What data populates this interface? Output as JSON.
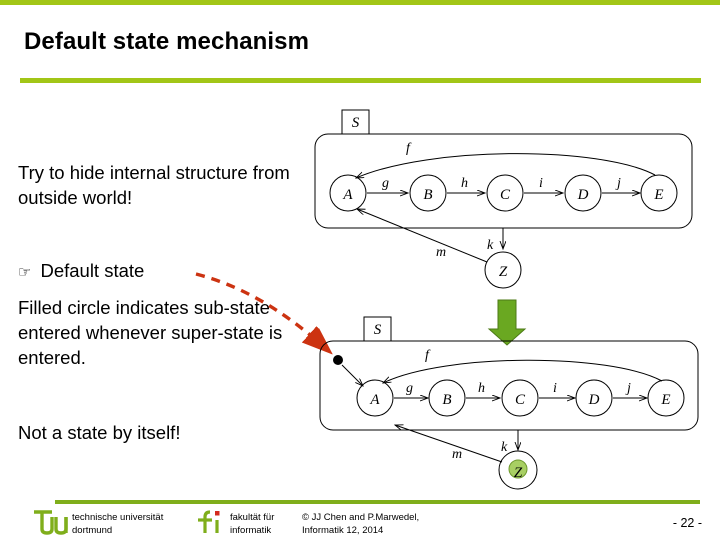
{
  "slide": {
    "title": "Default state mechanism",
    "page_number": "- 22 -",
    "accent_color": "#a2c617",
    "rule_color": "#7fae1b",
    "highlight_color": "#6aa821",
    "annotation_color": "#cc3311"
  },
  "body": {
    "paragraph_1": "Try to hide internal structure from outside world!",
    "bullet_glyph": "☞",
    "bullet_1": "Default state",
    "paragraph_2": "Filled circle indicates sub-state entered whenever super-state is entered.",
    "paragraph_3": "Not a state by itself!"
  },
  "diagram_top": {
    "super_state_label": "S",
    "states": [
      "A",
      "B",
      "C",
      "D",
      "E"
    ],
    "outside_state": "Z",
    "transitions": [
      {
        "label": "f",
        "from": "E",
        "to": "A"
      },
      {
        "label": "g",
        "from": "A",
        "to": "B"
      },
      {
        "label": "h",
        "from": "B",
        "to": "C"
      },
      {
        "label": "i",
        "from": "C",
        "to": "D"
      },
      {
        "label": "j",
        "from": "D",
        "to": "E"
      },
      {
        "label": "k",
        "from": "S",
        "to": "Z"
      },
      {
        "label": "m",
        "from": "Z",
        "to": "A"
      }
    ]
  },
  "diagram_bottom": {
    "super_state_label": "S",
    "states": [
      "A",
      "B",
      "C",
      "D",
      "E"
    ],
    "outside_state": "Z",
    "default_state_marker": "filled-circle",
    "transitions": [
      {
        "label": "f",
        "from": "E",
        "to": "A"
      },
      {
        "label": "g",
        "from": "A",
        "to": "B"
      },
      {
        "label": "h",
        "from": "B",
        "to": "C"
      },
      {
        "label": "i",
        "from": "C",
        "to": "D"
      },
      {
        "label": "j",
        "from": "D",
        "to": "E"
      },
      {
        "label": "k",
        "from": "S",
        "to": "Z"
      },
      {
        "label": "m",
        "from": "Z",
        "to": "S"
      }
    ]
  },
  "footer": {
    "tu_logo_text": "tu",
    "tu_name": "technische universität\ndortmund",
    "fi_logo_text": "fi",
    "fi_name": "fakultät für\ninformatik",
    "copyright": "© JJ Chen and  P.Marwedel,\nInformatik 12,  2014"
  }
}
